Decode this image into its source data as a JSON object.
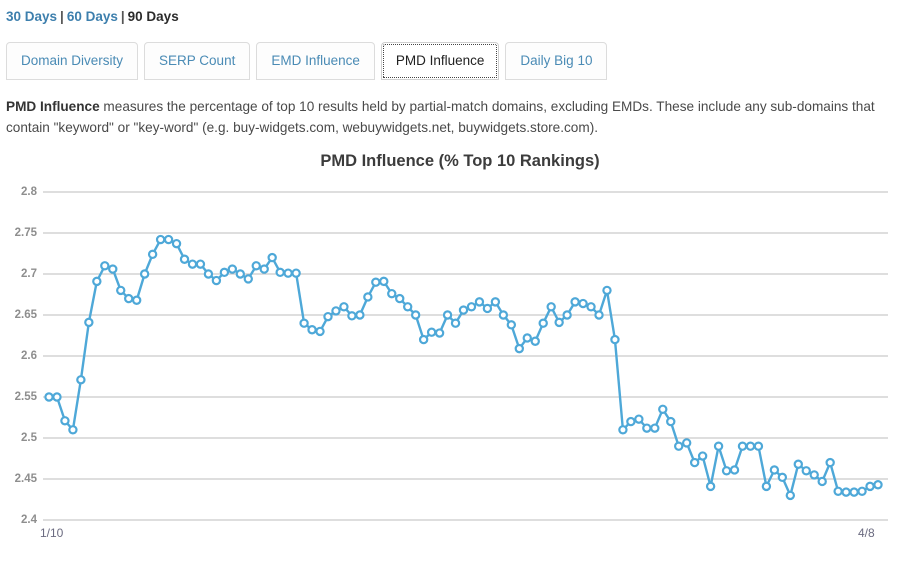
{
  "range_bar": {
    "options": [
      {
        "label": "30 Days",
        "active": false
      },
      {
        "label": "60 Days",
        "active": false
      },
      {
        "label": "90 Days",
        "active": true
      }
    ],
    "separator": "|"
  },
  "tabs": [
    {
      "label": "Domain Diversity",
      "active": false
    },
    {
      "label": "SERP Count",
      "active": false
    },
    {
      "label": "EMD Influence",
      "active": false
    },
    {
      "label": "PMD Influence",
      "active": true
    },
    {
      "label": "Daily Big 10",
      "active": false
    }
  ],
  "description": {
    "term": "PMD Influence",
    "text": " measures the percentage of top 10 results held by partial-match domains, excluding EMDs. These include any sub-domains that contain \"keyword\" or \"key-word\" (e.g. buy-widgets.com, webuywidgets.net, buywidgets.store.com)."
  },
  "colors": {
    "accent": "#4ea8d8",
    "link": "#3d7fad",
    "grid": "#bdbdbd",
    "axis_text": "#8e8e8e",
    "title": "#3c3c3c"
  },
  "chart_data": {
    "type": "line",
    "title": "PMD Influence (% Top 10 Rankings)",
    "xlabel": "",
    "ylabel": "",
    "grid": true,
    "legend": null,
    "ylim": [
      2.4,
      2.8
    ],
    "yticks": [
      2.4,
      2.45,
      2.5,
      2.55,
      2.6,
      2.65,
      2.7,
      2.75,
      2.8
    ],
    "ytick_labels": [
      "2.4",
      "2.45",
      "2.5",
      "2.55",
      "2.6",
      "2.65",
      "2.7",
      "2.75",
      "2.8"
    ],
    "xtick_labels": [
      "1/10",
      "4/8"
    ],
    "x_start": "1/10",
    "x_end": "4/8",
    "series": [
      {
        "name": "PMD Influence",
        "color": "#4ea8d8",
        "marker": "circle-open",
        "values": [
          2.55,
          2.55,
          2.521,
          2.51,
          2.571,
          2.641,
          2.691,
          2.71,
          2.706,
          2.68,
          2.67,
          2.668,
          2.7,
          2.724,
          2.742,
          2.742,
          2.737,
          2.718,
          2.712,
          2.712,
          2.7,
          2.692,
          2.702,
          2.706,
          2.7,
          2.694,
          2.71,
          2.706,
          2.72,
          2.702,
          2.701,
          2.701,
          2.64,
          2.632,
          2.63,
          2.648,
          2.655,
          2.66,
          2.649,
          2.65,
          2.672,
          2.69,
          2.691,
          2.676,
          2.67,
          2.66,
          2.65,
          2.62,
          2.629,
          2.628,
          2.65,
          2.64,
          2.656,
          2.66,
          2.666,
          2.658,
          2.666,
          2.65,
          2.638,
          2.609,
          2.622,
          2.618,
          2.64,
          2.66,
          2.641,
          2.65,
          2.666,
          2.664,
          2.66,
          2.65,
          2.68,
          2.62,
          2.51,
          2.52,
          2.523,
          2.512,
          2.512,
          2.535,
          2.52,
          2.49,
          2.494,
          2.47,
          2.478,
          2.441,
          2.49,
          2.46,
          2.461,
          2.49,
          2.49,
          2.49,
          2.441,
          2.461,
          2.452,
          2.43,
          2.468,
          2.46,
          2.455,
          2.447,
          2.47,
          2.435,
          2.434,
          2.434,
          2.435,
          2.441,
          2.443
        ]
      }
    ]
  }
}
